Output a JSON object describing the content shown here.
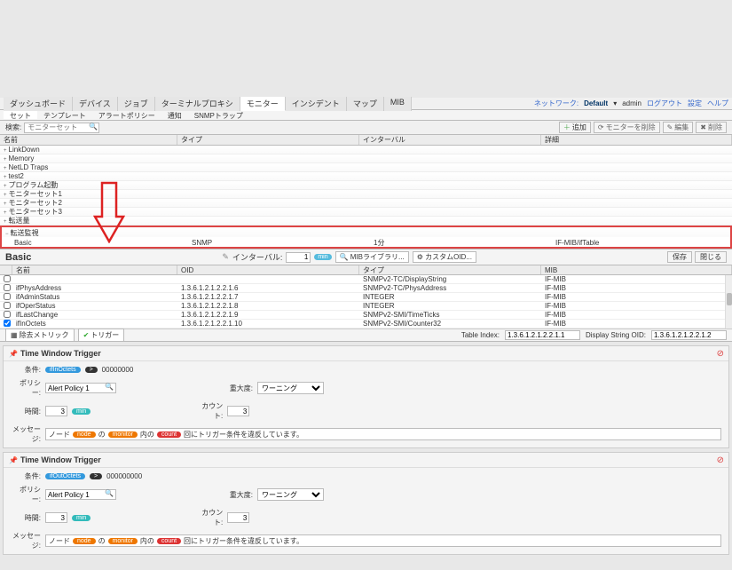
{
  "header": {
    "tabs": [
      "ダッシュボード",
      "デバイス",
      "ジョブ",
      "ターミナルプロキシ",
      "モニター",
      "インシデント",
      "マップ",
      "MIB"
    ],
    "active_tab": 4,
    "net_label": "ネットワーク:",
    "net_value": "Default",
    "user": "admin",
    "links": [
      "ログアウト",
      "設定",
      "ヘルプ"
    ]
  },
  "subtabs": {
    "items": [
      "セット",
      "テンプレート",
      "アラートポリシー",
      "通知",
      "SNMPトラップ"
    ],
    "active": 0
  },
  "toolbar": {
    "search_label": "検索:",
    "search_placeholder": "モニターセット",
    "buttons": {
      "add": "追加",
      "rename": "モニターを削除",
      "edit": "編集",
      "delete": "削除"
    }
  },
  "grid": {
    "cols": {
      "name": "名前",
      "type": "タイプ",
      "interval": "インターバル",
      "detail": "詳細"
    },
    "rows": [
      {
        "name": "LinkDown",
        "exp": "+"
      },
      {
        "name": "Memory",
        "exp": "+"
      },
      {
        "name": "NetLD Traps",
        "exp": "+"
      },
      {
        "name": "test2",
        "exp": "+"
      },
      {
        "name": "プログラム起動",
        "exp": "+"
      },
      {
        "name": "モニターセット1",
        "exp": "+"
      },
      {
        "name": "モニターセット2",
        "exp": "+"
      },
      {
        "name": "モニターセット3",
        "exp": "+"
      },
      {
        "name": "転送量",
        "exp": "+"
      },
      {
        "name": "転送監視",
        "exp": "-"
      }
    ],
    "expanded": {
      "name": "Basic",
      "type": "SNMP",
      "interval": "1分",
      "detail": "IF-MIB/ifTable"
    }
  },
  "basic": {
    "title": "Basic",
    "interval_label": "インターバル:",
    "interval_value": "1",
    "interval_unit": "min",
    "mib_lib": "MIBライブラリ...",
    "custom_oid": "カスタムOID...",
    "save": "保存",
    "close": "閉じる",
    "cols": {
      "name": "名前",
      "oid": "OID",
      "type": "タイプ",
      "mib": "MIB"
    },
    "rows": [
      {
        "chk": false,
        "name": "",
        "oid": "",
        "type": "SNMPv2-TC/DisplayString",
        "mib": "IF-MIB"
      },
      {
        "chk": false,
        "name": "ifPhysAddress",
        "oid": "1.3.6.1.2.1.2.2.1.6",
        "type": "SNMPv2-TC/PhysAddress",
        "mib": "IF-MIB"
      },
      {
        "chk": false,
        "name": "ifAdminStatus",
        "oid": "1.3.6.1.2.1.2.2.1.7",
        "type": "INTEGER",
        "mib": "IF-MIB"
      },
      {
        "chk": false,
        "name": "ifOperStatus",
        "oid": "1.3.6.1.2.1.2.2.1.8",
        "type": "INTEGER",
        "mib": "IF-MIB"
      },
      {
        "chk": false,
        "name": "ifLastChange",
        "oid": "1.3.6.1.2.1.2.2.1.9",
        "type": "SNMPv2-SMI/TimeTicks",
        "mib": "IF-MIB"
      },
      {
        "chk": true,
        "name": "ifInOctets",
        "oid": "1.3.6.1.2.1.2.2.1.10",
        "type": "SNMPv2-SMI/Counter32",
        "mib": "IF-MIB"
      }
    ],
    "foot": {
      "exclude_btn": "除去メトリック",
      "trigger_btn": "トリガー",
      "table_index_label": "Table Index:",
      "table_index_value": "1.3.6.1.2.1.2.2.1.1",
      "display_oid_label": "Display String OID:",
      "display_oid_value": "1.3.6.1.2.1.2.2.1.2"
    }
  },
  "triggers": [
    {
      "title": "Time Window Trigger",
      "cond_label": "条件:",
      "cond_badge": "ifInOctets",
      "cond_op": ">",
      "cond_val": "00000000",
      "policy_label": "ポリシー:",
      "policy_value": "Alert Policy 1",
      "sev_label": "重大度:",
      "sev_value": "ワーニング",
      "time_label": "時間:",
      "time_value": "3",
      "time_unit": "min",
      "count_label": "カウント:",
      "count_value": "3",
      "msg_label": "メッセージ:",
      "msg_parts": {
        "pre": "ノード",
        "node": "node",
        "mid": "の",
        "monitor": "monitor",
        "mid2": "内の",
        "count": "count",
        "suf": "回にトリガー条件を違反しています。"
      }
    },
    {
      "title": "Time Window Trigger",
      "cond_label": "条件:",
      "cond_badge": "ifOutOctets",
      "cond_op": ">",
      "cond_val": "000000000",
      "policy_label": "ポリシー:",
      "policy_value": "Alert Policy 1",
      "sev_label": "重大度:",
      "sev_value": "ワーニング",
      "time_label": "時間:",
      "time_value": "3",
      "time_unit": "min",
      "count_label": "カウント:",
      "count_value": "3",
      "msg_label": "メッセージ:",
      "msg_parts": {
        "pre": "ノード",
        "node": "node",
        "mid": "の",
        "monitor": "monitor",
        "mid2": "内の",
        "count": "count",
        "suf": "回にトリガー条件を違反しています。"
      }
    }
  ]
}
